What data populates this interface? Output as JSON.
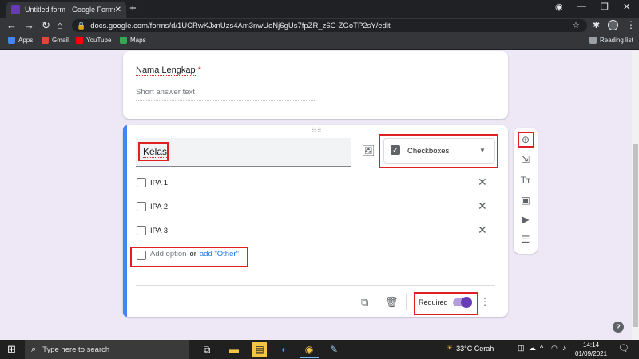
{
  "browser": {
    "tab_title": "Untitled form - Google Forms",
    "url_host": "docs.google.com",
    "url_path": "/forms/d/1UCRwKJxnUzs4Am3nwUeNj6gUs7fpZR_z6C-ZGoTP2sY/edit",
    "bookmarks": [
      {
        "label": "Apps",
        "color": "#ea4335"
      },
      {
        "label": "Gmail",
        "color": "#ea4335"
      },
      {
        "label": "YouTube",
        "color": "#ff0000"
      },
      {
        "label": "Maps",
        "color": "#34a853"
      }
    ],
    "reading_list": "Reading list"
  },
  "form": {
    "question1": {
      "title": "Nama Lengkap",
      "required_mark": "*",
      "placeholder": "Short answer text"
    },
    "question2": {
      "title": "Kelas",
      "type_label": "Checkboxes",
      "options": [
        {
          "label": "IPA 1"
        },
        {
          "label": "IPA 2"
        },
        {
          "label": "IPA 3"
        }
      ],
      "add_option": "Add option",
      "or_text": "or",
      "add_other": "add \"Other\"",
      "required_label": "Required",
      "required_on": true
    }
  },
  "accent_colors": {
    "form_purple": "#673ab7",
    "focus_blue": "#4285f4",
    "highlight_red": "#e02020"
  },
  "taskbar": {
    "search_placeholder": "Type here to search",
    "weather": "33°C  Cerah",
    "time": "14:14",
    "date": "01/09/2021"
  }
}
